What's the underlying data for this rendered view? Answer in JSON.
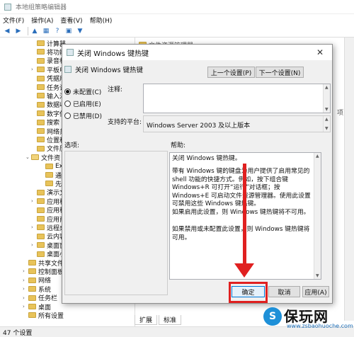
{
  "window": {
    "title": "本地组策略编辑器"
  },
  "menubar": [
    "文件(F)",
    "操作(A)",
    "查看(V)",
    "帮助(H)"
  ],
  "toolbar_icons": [
    "back-arrow-icon",
    "forward-arrow-icon",
    "folder-up-icon",
    "properties-icon",
    "help-icon",
    "show-pane-icon",
    "filter-icon"
  ],
  "tree": [
    {
      "label": "计算器",
      "chev": ""
    },
    {
      "label": "将功能",
      "chev": ""
    },
    {
      "label": "录音机",
      "chev": ""
    },
    {
      "label": "平板电",
      "chev": ">"
    },
    {
      "label": "凭据用",
      "chev": ""
    },
    {
      "label": "任务计",
      "chev": ""
    },
    {
      "label": "输入法",
      "chev": ""
    },
    {
      "label": "数据收",
      "chev": ""
    },
    {
      "label": "数字保",
      "chev": ""
    },
    {
      "label": "搜索",
      "chev": ""
    },
    {
      "label": "网络共",
      "chev": ""
    },
    {
      "label": "位置和",
      "chev": ""
    },
    {
      "label": "文件历",
      "chev": ""
    },
    {
      "label": "文件资",
      "chev": "v"
    },
    {
      "label": "Explo",
      "chev": ""
    },
    {
      "label": "通用",
      "chev": ""
    },
    {
      "label": "先前",
      "chev": ""
    },
    {
      "label": "演示文",
      "chev": ""
    },
    {
      "label": "应用程",
      "chev": ">"
    },
    {
      "label": "应用程",
      "chev": ""
    },
    {
      "label": "应用商",
      "chev": ""
    },
    {
      "label": "远程桌",
      "chev": ">"
    },
    {
      "label": "云内容",
      "chev": ""
    },
    {
      "label": "桌面窗",
      "chev": ">"
    },
    {
      "label": "桌面小",
      "chev": ""
    },
    {
      "label": "共享文件夹",
      "chev": ""
    },
    {
      "label": "控制面板",
      "chev": ">"
    },
    {
      "label": "网络",
      "chev": ">"
    },
    {
      "label": "系统",
      "chev": ">"
    },
    {
      "label": "任务栏",
      "chev": ">"
    },
    {
      "label": "桌面",
      "chev": ">"
    },
    {
      "label": "所有设置",
      "chev": ""
    }
  ],
  "right_pane": {
    "header": "文件资源管理器",
    "tabs": [
      "扩展",
      "标准"
    ],
    "side_text": [
      "项目"
    ]
  },
  "status": {
    "text": "47 个设置"
  },
  "dialog": {
    "title": "关闭 Windows 键热键",
    "setting_name": "关闭 Windows 键热键",
    "prev_button": "上一个设置(P)",
    "next_button": "下一个设置(N)",
    "radios": [
      {
        "label": "未配置(C)",
        "selected": true
      },
      {
        "label": "已启用(E)",
        "selected": false
      },
      {
        "label": "已禁用(D)",
        "selected": false
      }
    ],
    "comment_label": "注释:",
    "supported_label": "支持的平台:",
    "supported_value": "Windows Server 2003 及以上版本",
    "options_label": "选项:",
    "help_label": "帮助:",
    "help_paragraphs": [
      "关闭 Windows 键热键。",
      "带有 Windows 键的键盘为用户提供了启用常见的 shell 功能的快捷方式。例如，按下组合键 Windows+R 可打开“运行”对话框；按 Windows+E 可启动文件资源管理器。使用此设置可禁用这些 Windows 键热键。",
      "如果启用此设置，则 Windows 键热键将不可用。",
      "如果禁用或未配置此设置，则 Windows 键热键将可用。"
    ],
    "ok_button": "确定",
    "cancel_button": "取消",
    "apply_button": "应用(A)"
  },
  "annotation": {
    "color": "#e02020"
  },
  "watermark": {
    "logo_glyph": "S",
    "text": "保玩网",
    "url": "www.zsbaohuoche.com"
  }
}
